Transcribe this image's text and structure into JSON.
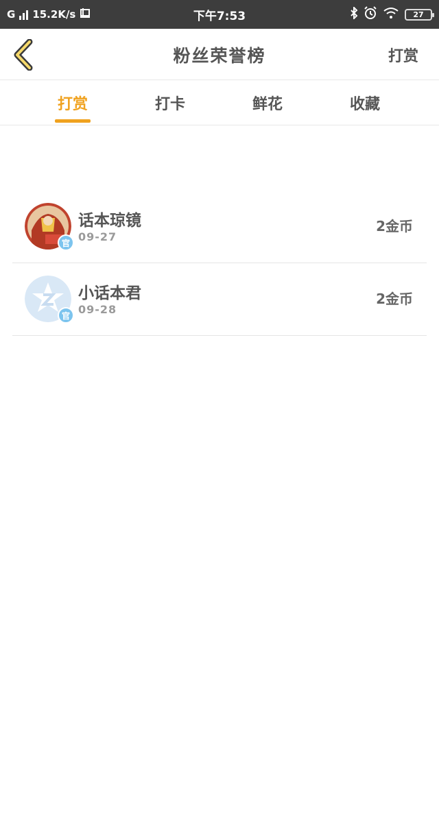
{
  "status_bar": {
    "network": "G",
    "speed": "15.2K/s",
    "time": "下午7:53",
    "battery": "27"
  },
  "nav": {
    "title": "粉丝荣誉榜",
    "right_action": "打赏"
  },
  "tabs": [
    {
      "label": "打赏",
      "active": true
    },
    {
      "label": "打卡",
      "active": false
    },
    {
      "label": "鲜花",
      "active": false
    },
    {
      "label": "收藏",
      "active": false
    }
  ],
  "list": [
    {
      "name": "话本琼镜",
      "date": "09-27",
      "amount": "2金币",
      "badge": "官"
    },
    {
      "name": "小话本君",
      "date": "09-28",
      "amount": "2金币",
      "badge": "官"
    }
  ],
  "colors": {
    "accent": "#f0a21f",
    "badge": "#7cc4ee",
    "status_bar": "#3d3d3d"
  }
}
